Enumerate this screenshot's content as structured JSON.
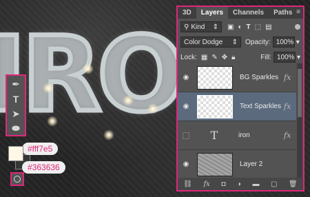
{
  "canvas": {
    "artwork_text": "IRON"
  },
  "toolbar": {
    "tools": [
      {
        "name": "pen-tool",
        "icon": "pen-icon",
        "glyph": "✒"
      },
      {
        "name": "type-tool",
        "icon": "type-icon",
        "glyph": "T"
      },
      {
        "name": "path-selection-tool",
        "icon": "arrow-icon",
        "glyph": "➤"
      },
      {
        "name": "ellipse-tool",
        "icon": "ellipse-icon",
        "glyph": "⬬"
      }
    ],
    "foreground_color": "#fff7e5",
    "background_color": "#363636",
    "foreground_label": "#fff7e5",
    "background_label": "#363636"
  },
  "panel": {
    "tabs": [
      "3D",
      "Layers",
      "Channels",
      "Paths"
    ],
    "active_tab": "Layers",
    "filter_kind": "Kind",
    "blend_mode": "Color Dodge",
    "opacity_label": "Opacity:",
    "opacity_value": "100%",
    "lock_label": "Lock:",
    "fill_label": "Fill:",
    "fill_value": "100%",
    "layers": [
      {
        "name": "BG Sparkles",
        "visible": true,
        "fx": "fx",
        "selected": false
      },
      {
        "name": "Text Sparkles",
        "visible": true,
        "fx": "fx",
        "selected": true
      },
      {
        "name": "iron",
        "visible": false,
        "fx": "fx",
        "selected": false
      },
      {
        "name": "Layer 2",
        "visible": true,
        "fx": "",
        "selected": false
      }
    ],
    "accent_color": "#e0267a"
  }
}
